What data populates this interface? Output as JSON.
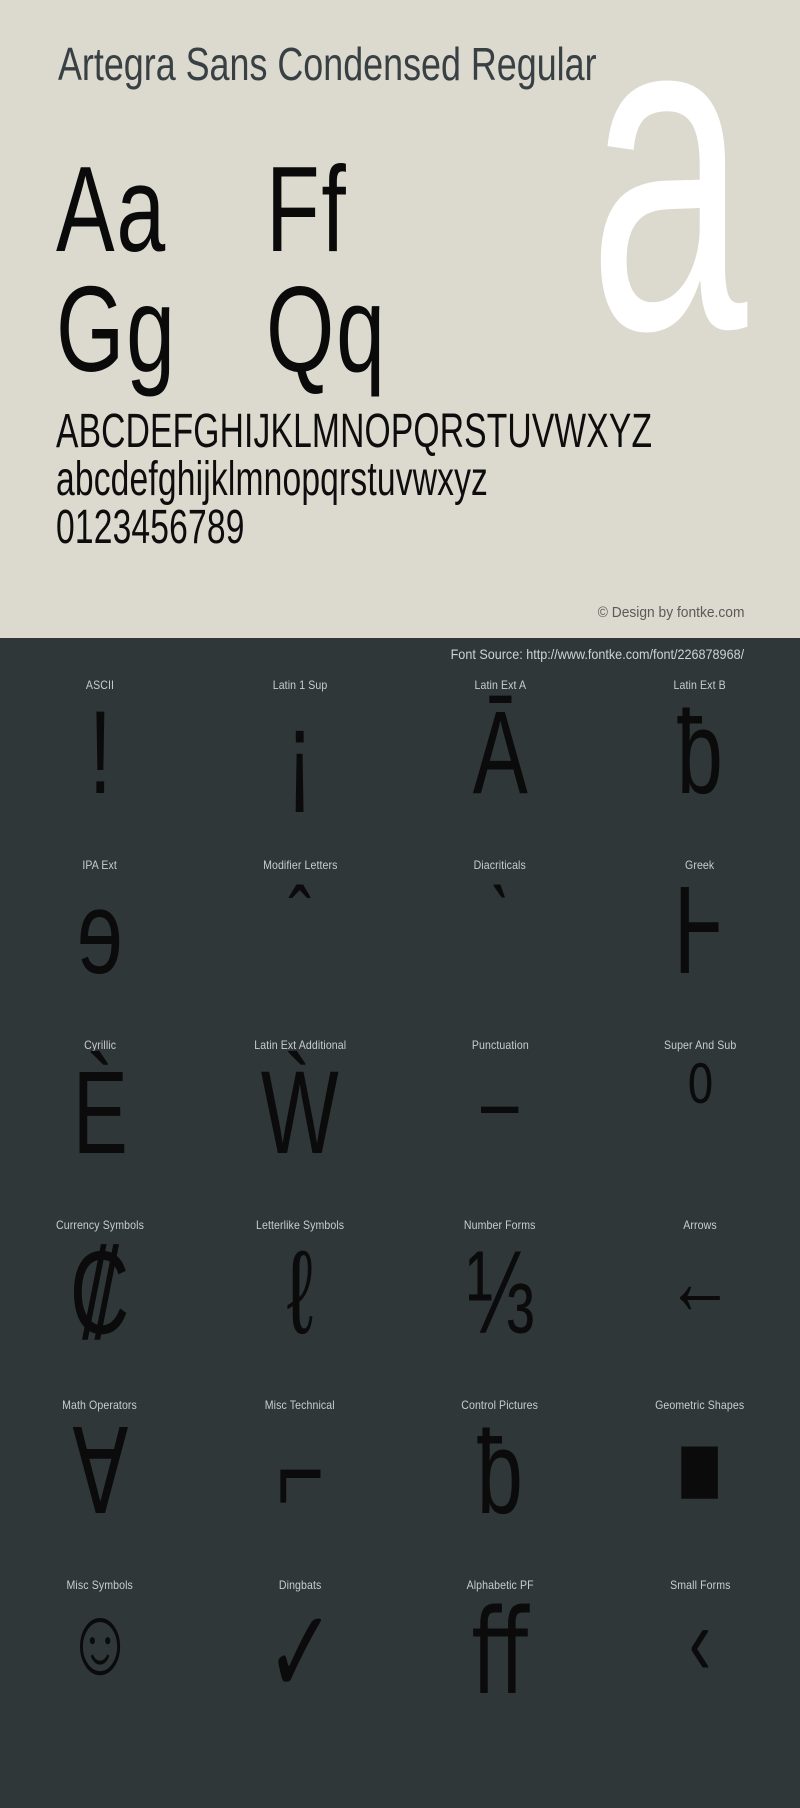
{
  "specimen": {
    "title": "Artegra Sans Condensed Regular",
    "watermark_letter": "a",
    "sample_pairs": [
      "Aa",
      "Ff",
      "Gg",
      "Qq"
    ],
    "alphabet_upper": "ABCDEFGHIJKLMNOPQRSTUVWXYZ",
    "alphabet_lower": "abcdefghijklmnopqrstuvwxyz",
    "digits": "0123456789",
    "copyright": "© Design by fontke.com",
    "font_source": "Font Source: http://www.fontke.com/font/226878968/",
    "colors": {
      "top_background": "#dcd9cf",
      "bottom_background": "#2f3739",
      "title_text": "#394044",
      "glyph_black": "#0b0b0b",
      "watermark": "#ffffff",
      "label_text": "#c9cdcc",
      "copyright_text": "#5a5a56"
    }
  },
  "unicode_blocks": [
    {
      "label": "ASCII",
      "glyph": "!",
      "glyph_name": "exclamation-mark-glyph"
    },
    {
      "label": "Latin 1 Sup",
      "glyph": "¡",
      "glyph_name": "inverted-exclamation-glyph"
    },
    {
      "label": "Latin Ext A",
      "glyph": "Ā",
      "glyph_name": "a-macron-glyph"
    },
    {
      "label": "Latin Ext B",
      "glyph": "ƀ",
      "glyph_name": "b-with-stroke-glyph"
    },
    {
      "label": "IPA Ext",
      "glyph": "ɘ",
      "glyph_name": "reversed-e-glyph"
    },
    {
      "label": "Modifier Letters",
      "glyph": "ˆ",
      "glyph_name": "circumflex-accent-glyph"
    },
    {
      "label": "Diacriticals",
      "glyph": "ˋ",
      "glyph_name": "grave-accent-glyph"
    },
    {
      "label": "Greek",
      "glyph": "Ͱ",
      "glyph_name": "greek-heta-glyph"
    },
    {
      "label": "Cyrillic",
      "glyph": "Ѐ",
      "glyph_name": "cyrillic-ie-grave-glyph"
    },
    {
      "label": "Latin Ext Additional",
      "glyph": "Ẁ",
      "glyph_name": "w-grave-glyph"
    },
    {
      "label": "Punctuation",
      "glyph": "–",
      "glyph_name": "en-dash-glyph"
    },
    {
      "label": "Super And Sub",
      "glyph": "⁰",
      "glyph_name": "superscript-zero-glyph"
    },
    {
      "label": "Currency Symbols",
      "glyph": "₡",
      "glyph_name": "colon-currency-glyph"
    },
    {
      "label": "Letterlike Symbols",
      "glyph": "ℓ",
      "glyph_name": "script-small-l-glyph"
    },
    {
      "label": "Number Forms",
      "glyph": "⅓",
      "glyph_name": "one-third-fraction-glyph"
    },
    {
      "label": "Arrows",
      "glyph": "←",
      "glyph_name": "left-arrow-glyph"
    },
    {
      "label": "Math Operators",
      "glyph": "∀",
      "glyph_name": "for-all-glyph"
    },
    {
      "label": "Misc Technical",
      "glyph": "⌐",
      "glyph_name": "reversed-not-sign-glyph"
    },
    {
      "label": "Control Pictures",
      "glyph": "ƀ",
      "glyph_name": "b-with-stroke-glyph"
    },
    {
      "label": "Geometric Shapes",
      "glyph": "■",
      "glyph_name": "filled-square-glyph"
    },
    {
      "label": "Misc Symbols",
      "glyph": "☺",
      "glyph_name": "smiling-face-glyph"
    },
    {
      "label": "Dingbats",
      "glyph": "✓",
      "glyph_name": "check-mark-glyph"
    },
    {
      "label": "Alphabetic PF",
      "glyph": "ﬀ",
      "glyph_name": "ff-ligature-glyph"
    },
    {
      "label": "Small Forms",
      "glyph": "‹",
      "glyph_name": "single-left-angle-quote-glyph"
    }
  ]
}
